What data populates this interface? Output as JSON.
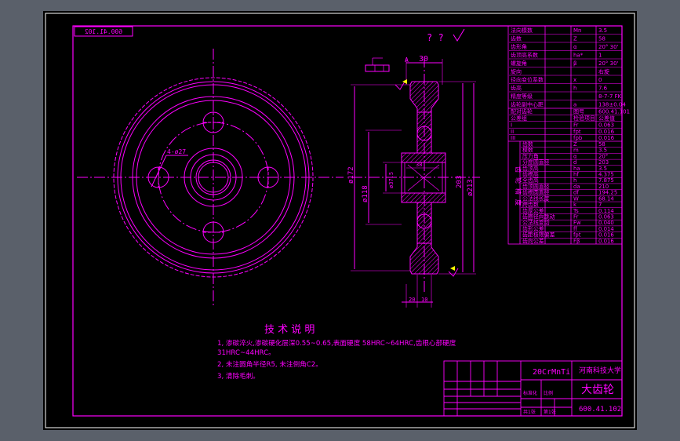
{
  "colors": {
    "app_background": "#5a606a",
    "sheet": "#000000",
    "line": "#ff00ff",
    "white_line": "#ffffff",
    "cyan_line": "#00ffff"
  },
  "drawing_number_mirrored": "600.41.102",
  "surface_finish": "? ?",
  "section_dims": {
    "width_30": "30",
    "d172": "ø172",
    "d118": "ø118",
    "d37_5": "ø37.5",
    "dim_203": "203",
    "d213": "ø213",
    "dim_38": "38",
    "dim_10": "10",
    "dim_20": "20",
    "datum_a": "A"
  },
  "front_view": {
    "hole_label": "4-ø27"
  },
  "tech_notes": {
    "title": "技 术 说 明",
    "line1": "1, 渗碳淬火,渗碳硬化层深0.55~0.65,表面硬度 58HRC~64HRC,齿根心部硬度",
    "line2": "31HRC~44HRC。",
    "line3": "2, 未注圆角半径R5, 未注倒角C2。",
    "line4": "3, 清除毛刺。"
  },
  "title_block": {
    "material": "20CrMnTi",
    "school": "河南科技大学",
    "part_name": "大齿轮",
    "drawing_number": "600.41.102",
    "small_labels": [
      "标准化",
      "比例",
      "共1张",
      "第1张"
    ]
  },
  "parameter_table": {
    "upper_rows": [
      [
        "法向模数",
        "Mn",
        "3.5"
      ],
      [
        "齿数",
        "Z",
        "58"
      ],
      [
        "齿形角",
        "α",
        "20° 30'"
      ],
      [
        "齿顶高系数",
        "ha*",
        "1"
      ],
      [
        "螺旋角",
        "β",
        "20° 30'"
      ],
      [
        "旋向",
        "",
        "右旋"
      ],
      [
        "径向变位系数",
        "x",
        "0"
      ],
      [
        "齿高",
        "h",
        "7.6"
      ],
      [
        "精度等级",
        "",
        "8-7-7 FK"
      ],
      [
        "齿轮副中心距",
        "a",
        "138±0.04"
      ]
    ],
    "mid_rows": [
      [
        "配对齿轮",
        "图号",
        "600.41.101"
      ],
      [
        "公差组",
        "检验项目",
        "公差值"
      ],
      [
        "I",
        "Fr",
        "0.063"
      ],
      [
        "II",
        "fpt",
        "0.016"
      ],
      [
        "III",
        "fpb",
        "0.016"
      ]
    ],
    "lower_rows": [
      [
        "齿数",
        "Z",
        "58"
      ],
      [
        "模数",
        "m",
        "3.5"
      ],
      [
        "压力角",
        "α",
        "20°"
      ],
      [
        "分度圆直径",
        "d",
        "203"
      ],
      [
        "齿顶高",
        "ha",
        "3.5"
      ],
      [
        "齿根高",
        "hf",
        "4.375"
      ],
      [
        "全齿高",
        "h",
        "7.875"
      ],
      [
        "齿顶圆直径",
        "da",
        "210"
      ],
      [
        "齿根圆直径",
        "df",
        "194.25"
      ],
      [
        "公法线长度",
        "W",
        "68.14"
      ],
      [
        "跨齿数",
        "k",
        "7"
      ],
      [
        "齿厚公差",
        "Ts",
        "0.114"
      ],
      [
        "齿圈径向跳动",
        "Fr",
        "0.063"
      ],
      [
        "公法线变动",
        "Fw",
        "0.040"
      ],
      [
        "齿形公差",
        "ff",
        "0.014"
      ],
      [
        "齿距极限偏差",
        "fpt",
        "0.016"
      ],
      [
        "齿向公差",
        "Fβ",
        "0.016"
      ]
    ],
    "side_label": "齿轮精度"
  }
}
